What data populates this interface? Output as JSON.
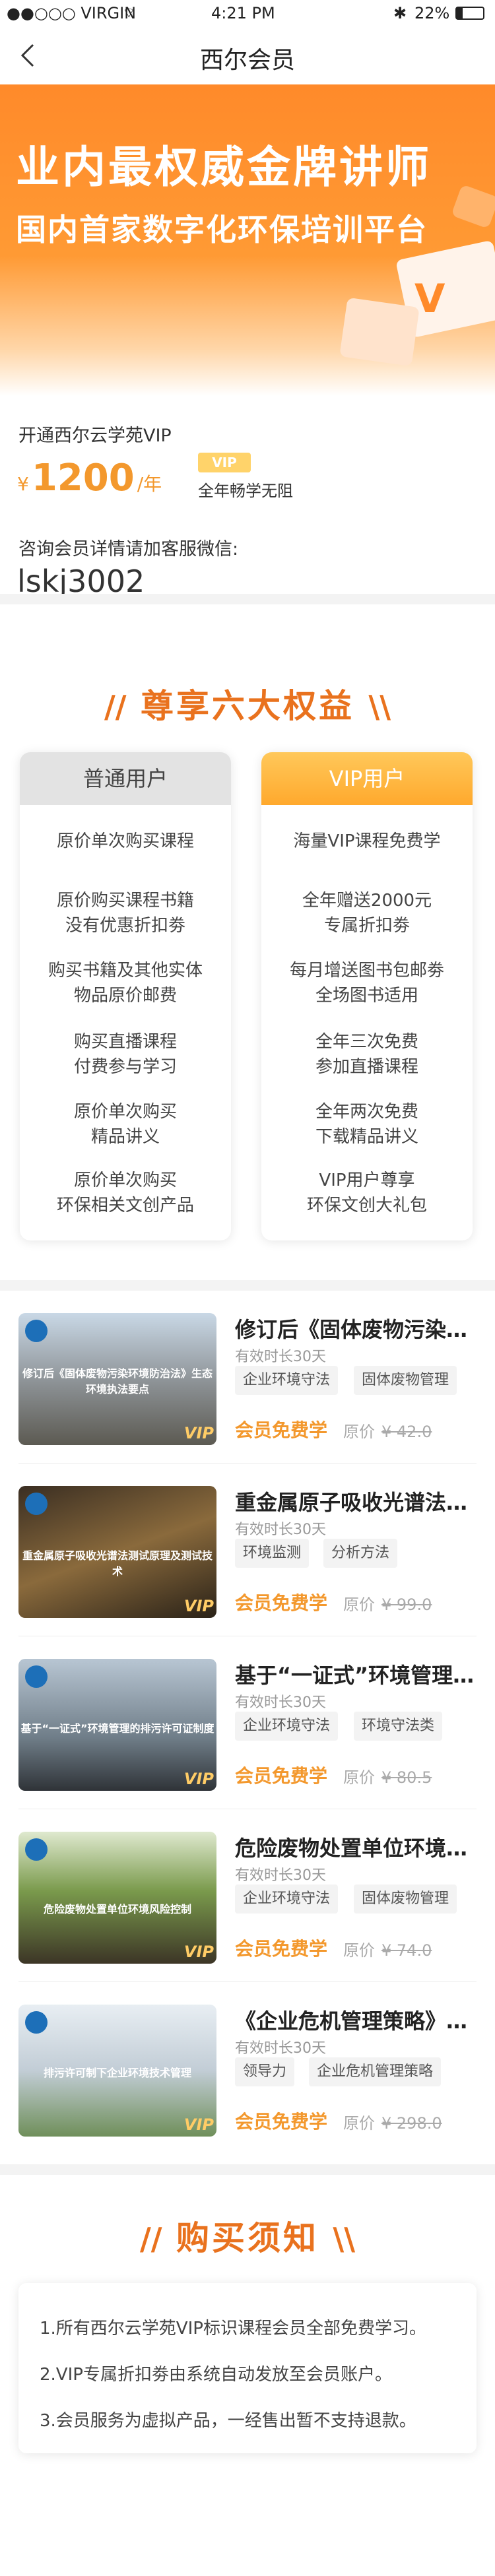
{
  "status_bar": {
    "carrier": "●●○○○ VIRGIN",
    "time": "4:21 PM",
    "battery": "22%"
  },
  "nav": {
    "title": "西尔会员"
  },
  "banner": {
    "line1": "业内最权威金牌讲师",
    "line2": "国内首家数字化环保培训平台"
  },
  "vip": {
    "open_text": "开通西尔云学苑VIP",
    "currency": "¥",
    "price": "1200",
    "unit": "/年",
    "badge": "VIP",
    "year_text": "全年畅学无阻",
    "consult_text": "咨询会员详情请加客服微信:",
    "wechat": "lskj3002"
  },
  "benefits": {
    "title": "尊享六大权益",
    "slash_left": "//",
    "slash_right": "\\\\",
    "normal_header": "普通用户",
    "vip_header": "VIP用户",
    "normal_items": [
      [
        "原价单次购买课程",
        ""
      ],
      [
        "原价购买课程书籍",
        "没有优惠折扣劵"
      ],
      [
        "购买书籍及其他实体",
        "物品原价邮费"
      ],
      [
        "购买直播课程",
        "付费参与学习"
      ],
      [
        "原价单次购买",
        "精品讲义"
      ],
      [
        "原价单次购买",
        "环保相关文创产品"
      ]
    ],
    "vip_items": [
      [
        "海量VIP课程免费学",
        ""
      ],
      [
        "全年赠送2000元",
        "专属折扣劵"
      ],
      [
        "每月增送图书包邮劵",
        "全场图书适用"
      ],
      [
        "全年三次免费",
        "参加直播课程"
      ],
      [
        "全年两次免费",
        "下载精品讲义"
      ],
      [
        "VIP用户尊享",
        "环保文创大礼包"
      ]
    ]
  },
  "courses": [
    {
      "name": "修订后《固体废物污染环境防治法》生态环境执法要点",
      "valid": "有效时长30天",
      "tags": [
        "企业环境守法",
        "固体废物管理"
      ],
      "free": "会员免费学",
      "orig_label": "原价",
      "orig_price": "¥ 42.0",
      "thumb_caption": "修订后《固体废物污染环境防治法》生态环境执法要点",
      "thumb_vip": "VIP"
    },
    {
      "name": "重金属原子吸收光谱法测试原理及测试技术",
      "valid": "有效时长30天",
      "tags": [
        "环境监测",
        "分析方法"
      ],
      "free": "会员免费学",
      "orig_label": "原价",
      "orig_price": "¥ 99.0",
      "thumb_caption": "重金属原子吸收光谱法测试原理及测试技术",
      "thumb_vip": "VIP"
    },
    {
      "name": "基于“一证式”环境管理的排污许可证制度",
      "valid": "有效时长30天",
      "tags": [
        "企业环境守法",
        "环境守法类"
      ],
      "free": "会员免费学",
      "orig_label": "原价",
      "orig_price": "¥ 80.5",
      "thumb_caption": "基于“一证式”环境管理的排污许可证制度",
      "thumb_vip": "VIP"
    },
    {
      "name": "危险废物处置单位环境风险控制",
      "valid": "有效时长30天",
      "tags": [
        "企业环境守法",
        "固体废物管理"
      ],
      "free": "会员免费学",
      "orig_label": "原价",
      "orig_price": "¥ 74.0",
      "thumb_caption": "危险废物处置单位环境风险控制",
      "thumb_vip": "VIP"
    },
    {
      "name": "《企业危机管理策略》企业环境应对",
      "valid": "有效时长30天",
      "tags": [
        "领导力",
        "企业危机管理策略"
      ],
      "free": "会员免费学",
      "orig_label": "原价",
      "orig_price": "¥ 298.0",
      "thumb_caption": "排污许可制下企业环境技术管理",
      "thumb_vip": "VIP"
    }
  ],
  "notice": {
    "title": "购买须知",
    "items": [
      "1.所有西尔云学苑VIP标识课程会员全部免费学习。",
      "2.VIP专属折扣劵由系统自动发放至会员账户。",
      "3.会员服务为虚拟产品，一经售出暂不支持退款。"
    ]
  },
  "colors": {
    "accent": "#e9721e",
    "orange": "#f3982d",
    "vip_gold": "#ffa92d"
  }
}
